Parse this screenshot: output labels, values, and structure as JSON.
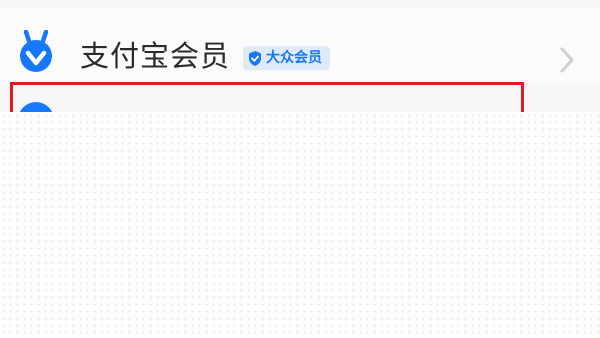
{
  "membership": {
    "title": "支付宝会员",
    "tier_label": "大众会员",
    "icon": "alipay-member-icon",
    "tier_icon": "shield-check-icon",
    "arrow_icon": "chevron-right-icon"
  },
  "colors": {
    "brand_blue": "#1677ff",
    "badge_bg": "#dfeaf8",
    "highlight_red": "#e11b1b",
    "title_text": "#2b2b2b",
    "chevron": "#cfcfcf"
  }
}
